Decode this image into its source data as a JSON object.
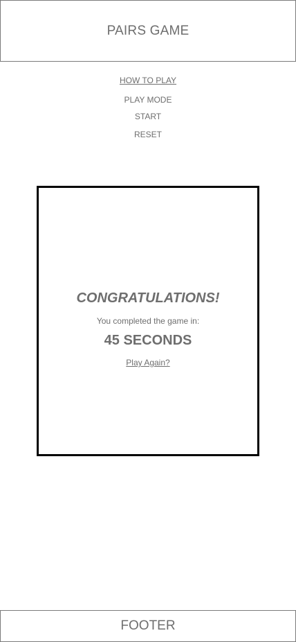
{
  "header": {
    "title": "PAIRS GAME"
  },
  "menu": {
    "how_to_play": "HOW TO PLAY",
    "play_mode": "PLAY MODE",
    "start": "START",
    "reset": "RESET"
  },
  "result_modal": {
    "heading": "CONGRATULATIONS!",
    "message": "You completed the game in:",
    "time": "45 SECONDS",
    "play_again": "Play Again?"
  },
  "footer": {
    "label": "FOOTER"
  },
  "colors": {
    "text": "#6e6e6e",
    "border": "#7a7a7a",
    "modal_border": "#000000",
    "background": "#ffffff"
  }
}
